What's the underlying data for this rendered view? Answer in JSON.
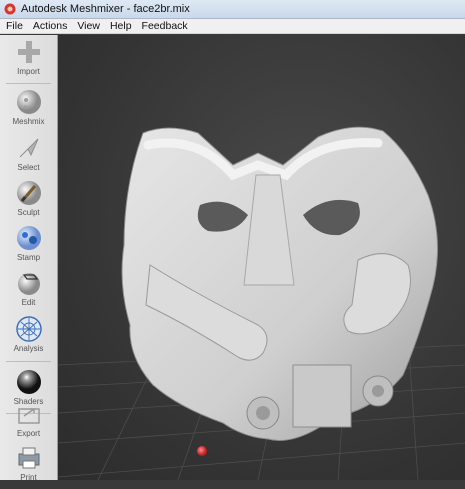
{
  "window": {
    "title": "Autodesk Meshmixer - face2br.mix",
    "app_icon": "meshmixer-logo-icon"
  },
  "menu": {
    "items": [
      "File",
      "Actions",
      "View",
      "Help",
      "Feedback"
    ]
  },
  "toolbar": {
    "items": [
      {
        "label": "Import",
        "icon": "plus-icon"
      },
      {
        "label": "Meshmix",
        "icon": "meshmix-sphere-icon"
      },
      {
        "label": "Select",
        "icon": "cursor-arrow-icon"
      },
      {
        "label": "Sculpt",
        "icon": "brush-icon"
      },
      {
        "label": "Stamp",
        "icon": "stamp-icon"
      },
      {
        "label": "Edit",
        "icon": "edit-icon"
      },
      {
        "label": "Analysis",
        "icon": "analysis-icon"
      },
      {
        "label": "Shaders",
        "icon": "shader-sphere-icon"
      },
      {
        "label": "Export",
        "icon": "export-icon"
      },
      {
        "label": "Print",
        "icon": "printer-icon"
      }
    ]
  },
  "viewport": {
    "background_color": "#3a3a3a",
    "grid_color": "#4d4d4d",
    "model_color": "#d2d2d2",
    "pivot_color": "#e23a3a"
  }
}
